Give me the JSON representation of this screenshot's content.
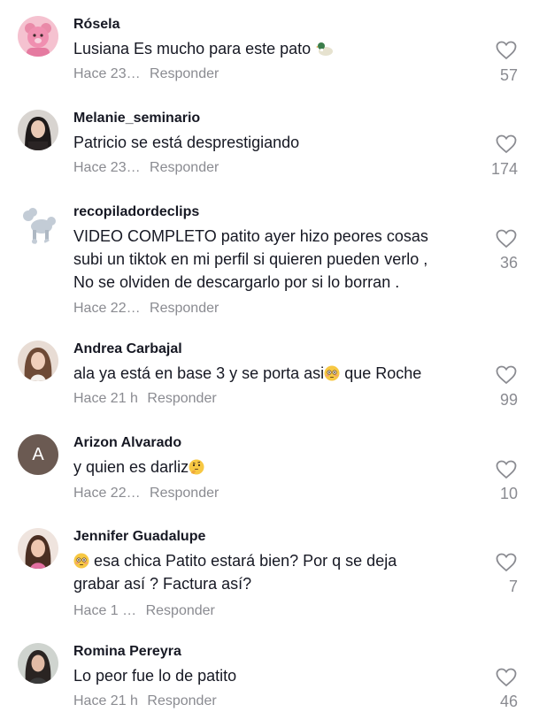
{
  "comments": [
    {
      "username": "Rósela",
      "lines": [
        "Lusiana Es mucho para este pato"
      ],
      "time": "Hace 23…",
      "reply": "Responder",
      "likes": "57",
      "avatar_icon": "teddy-bear-avatar",
      "emoji": "duck-emoji"
    },
    {
      "username": "Melanie_seminario",
      "lines": [
        "Patricio se está desprestigiando"
      ],
      "time": "Hace 23…",
      "reply": "Responder",
      "likes": "174",
      "avatar_icon": "person-photo-avatar"
    },
    {
      "username": "recopiladordeclips",
      "lines": [
        "VIDEO COMPLETO patito ayer hizo peores cosas",
        "subi un tiktok en mi perfil si quieren pueden verlo ,",
        "No se olviden de descargarlo por si lo borran ."
      ],
      "time": "Hace 22…",
      "reply": "Responder",
      "likes": "36",
      "avatar_icon": "poodle-avatar"
    },
    {
      "username": "Andrea Carbajal",
      "lines": [
        "ala ya está en base 3 y se porta asi",
        " que Roche"
      ],
      "time": "Hace 21 h",
      "reply": "Responder",
      "likes": "99",
      "avatar_icon": "person-photo-avatar",
      "emoji": "flushed-emoji"
    },
    {
      "username": "Arizon Alvarado",
      "lines": [
        "y quien es darliz"
      ],
      "time": "Hace 22…",
      "reply": "Responder",
      "likes": "10",
      "avatar_icon": "letter-avatar",
      "avatar_letter": "A",
      "emoji": "thinking-emoji"
    },
    {
      "username": "Jennifer Guadalupe",
      "lines": [
        " esa chica Patito estará bien? Por q se deja",
        "grabar así ? Factura así?"
      ],
      "time": "Hace 1 …",
      "reply": "Responder",
      "likes": "7",
      "avatar_icon": "person-photo-avatar",
      "emoji": "flushed-emoji"
    },
    {
      "username": "Romina Pereyra",
      "lines": [
        "Lo peor fue lo de patito"
      ],
      "time": "Hace 21 h",
      "reply": "Responder",
      "likes": "46",
      "avatar_icon": "person-photo-avatar"
    }
  ],
  "colors": {
    "text": "#161823",
    "muted": "#8a8b91",
    "letter_avatar_bg": "#6b5a52"
  }
}
